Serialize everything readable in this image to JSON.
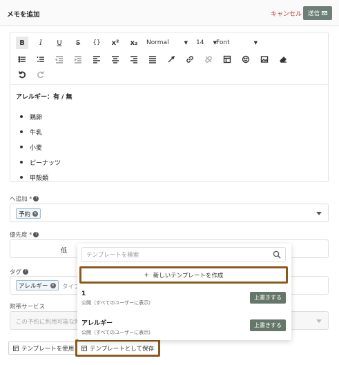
{
  "header": {
    "title": "メモを追加",
    "cancel_label": "キャンセル",
    "send_label": "送信"
  },
  "toolbar": {
    "format_select": "Normal",
    "size_select": "14",
    "font_select": "Font",
    "icons": [
      "bold-icon",
      "italic-icon",
      "underline-icon",
      "strikethrough-icon",
      "code-icon",
      "superscript-icon",
      "subscript-icon",
      "bullet-list-icon",
      "numbered-list-icon",
      "outdent-icon",
      "indent-icon",
      "align-left-icon",
      "align-center-icon",
      "align-right-icon",
      "align-justify-icon",
      "text-color-icon",
      "link-icon",
      "unlink-icon",
      "table-icon",
      "emoji-icon",
      "image-icon",
      "eraser-icon",
      "undo-icon",
      "redo-icon"
    ]
  },
  "content": {
    "heading": "アレルギー：有 / 無",
    "items": [
      "鶏卵",
      "牛乳",
      "小麦",
      "ピーナッツ",
      "甲殻類"
    ]
  },
  "add_to": {
    "label": "へ追加 *",
    "chip": "予約"
  },
  "priority": {
    "label": "優先度 *",
    "value": "低"
  },
  "tags": {
    "label": "タグ",
    "chip": "アレルギー",
    "placeholder": "タイプ"
  },
  "paid_service": {
    "label": "附帯サービス",
    "placeholder": "この予約に利用可能な附"
  },
  "dropdown": {
    "search_placeholder": "テンプレートを検索",
    "create_label": "新しいテンプレートを作成",
    "templates": [
      {
        "name": "1",
        "meta": "公開（すべてのユーザーに表示）",
        "button": "上書きする"
      },
      {
        "name": "アレルギー",
        "meta": "公開（すべてのユーザーに表示）",
        "button": "上書きする"
      }
    ]
  },
  "bottom": {
    "use_template": "テンプレートを使用",
    "save_template": "テンプレートとして保存"
  }
}
